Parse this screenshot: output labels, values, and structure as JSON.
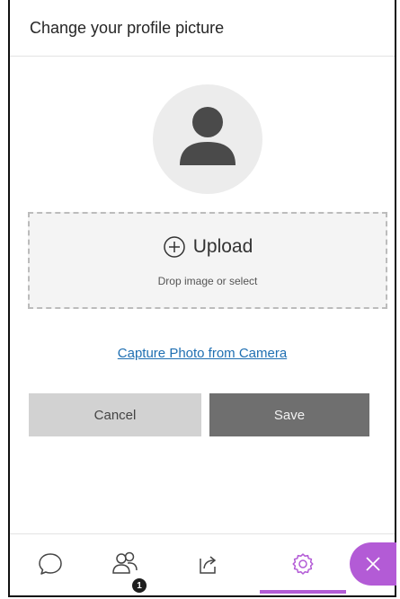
{
  "header": {
    "title": "Change your profile picture"
  },
  "avatar": {
    "icon": "user-silhouette-icon"
  },
  "upload": {
    "icon": "plus-circle-icon",
    "label": "Upload",
    "hint": "Drop image or select"
  },
  "capture": {
    "label": "Capture Photo from Camera"
  },
  "actions": {
    "cancel_label": "Cancel",
    "save_label": "Save"
  },
  "toolbar": {
    "items": [
      {
        "name": "chat",
        "icon": "chat-bubble-icon"
      },
      {
        "name": "attendees",
        "icon": "people-icon",
        "badge": "1"
      },
      {
        "name": "share",
        "icon": "share-icon"
      },
      {
        "name": "settings",
        "icon": "gear-icon",
        "active": true
      }
    ],
    "close_icon": "close-icon"
  },
  "colors": {
    "accent": "#b35bd6",
    "link": "#1f6fb2",
    "save_bg": "#6f6f6f",
    "cancel_bg": "#d2d2d2"
  }
}
